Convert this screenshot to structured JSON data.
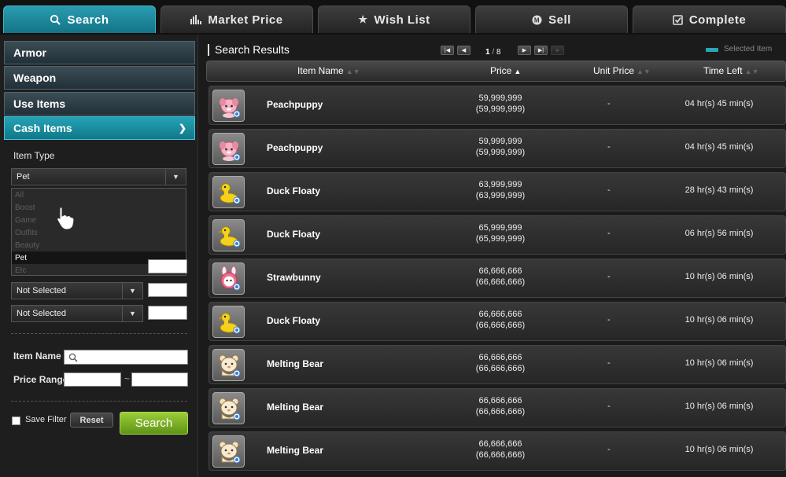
{
  "tabs": [
    {
      "label": "Search",
      "icon": "search-icon",
      "active": true
    },
    {
      "label": "Market Price",
      "icon": "bar-chart-icon",
      "active": false
    },
    {
      "label": "Wish List",
      "icon": "star-icon",
      "active": false
    },
    {
      "label": "Sell",
      "icon": "meso-coin-icon",
      "active": false
    },
    {
      "label": "Complete",
      "icon": "checkbox-icon",
      "active": false
    }
  ],
  "sidebar": {
    "categories": [
      {
        "label": "Armor"
      },
      {
        "label": "Weapon"
      },
      {
        "label": "Use Items"
      },
      {
        "label": "Cash Items",
        "active": true
      }
    ],
    "item_type_label": "Item Type",
    "item_type_value": "Pet",
    "item_type_options": [
      "All",
      "Boost",
      "Game",
      "Outfits",
      "Beauty",
      "Pet",
      "Etc"
    ],
    "filter_1": "Not Selected",
    "filter_2": "Not Selected",
    "item_name_label": "Item Name",
    "price_range_label": "Price Range",
    "price_range_sep": "~",
    "save_filter_label": "Save Filter",
    "reset_label": "Reset",
    "search_label": "Search"
  },
  "main": {
    "title": "Search Results",
    "page_current": "1",
    "page_total": "8",
    "legend_label": "Selected Item",
    "legend_color": "#2aa7b6",
    "columns": [
      "Item Name",
      "Price",
      "Unit Price",
      "Time Left"
    ],
    "rows": [
      {
        "name": "Peachpuppy",
        "price": "59,999,999",
        "price_sub": "(59,999,999)",
        "unit": "-",
        "time": "04 hr(s) 45 min(s)",
        "icon": "peachpuppy-icon"
      },
      {
        "name": "Peachpuppy",
        "price": "59,999,999",
        "price_sub": "(59,999,999)",
        "unit": "-",
        "time": "04 hr(s) 45 min(s)",
        "icon": "peachpuppy-icon"
      },
      {
        "name": "Duck Floaty",
        "price": "63,999,999",
        "price_sub": "(63,999,999)",
        "unit": "-",
        "time": "28 hr(s) 43 min(s)",
        "icon": "duck-floaty-icon"
      },
      {
        "name": "Duck Floaty",
        "price": "65,999,999",
        "price_sub": "(65,999,999)",
        "unit": "-",
        "time": "06 hr(s) 56 min(s)",
        "icon": "duck-floaty-icon"
      },
      {
        "name": "Strawbunny",
        "price": "66,666,666",
        "price_sub": "(66,666,666)",
        "unit": "-",
        "time": "10 hr(s) 06 min(s)",
        "icon": "strawbunny-icon"
      },
      {
        "name": "Duck Floaty",
        "price": "66,666,666",
        "price_sub": "(66,666,666)",
        "unit": "-",
        "time": "10 hr(s) 06 min(s)",
        "icon": "duck-floaty-icon"
      },
      {
        "name": "Melting Bear",
        "price": "66,666,666",
        "price_sub": "(66,666,666)",
        "unit": "-",
        "time": "10 hr(s) 06 min(s)",
        "icon": "melting-bear-icon"
      },
      {
        "name": "Melting Bear",
        "price": "66,666,666",
        "price_sub": "(66,666,666)",
        "unit": "-",
        "time": "10 hr(s) 06 min(s)",
        "icon": "melting-bear-icon"
      },
      {
        "name": "Melting Bear",
        "price": "66,666,666",
        "price_sub": "(66,666,666)",
        "unit": "-",
        "time": "10 hr(s) 06 min(s)",
        "icon": "melting-bear-icon"
      }
    ]
  }
}
